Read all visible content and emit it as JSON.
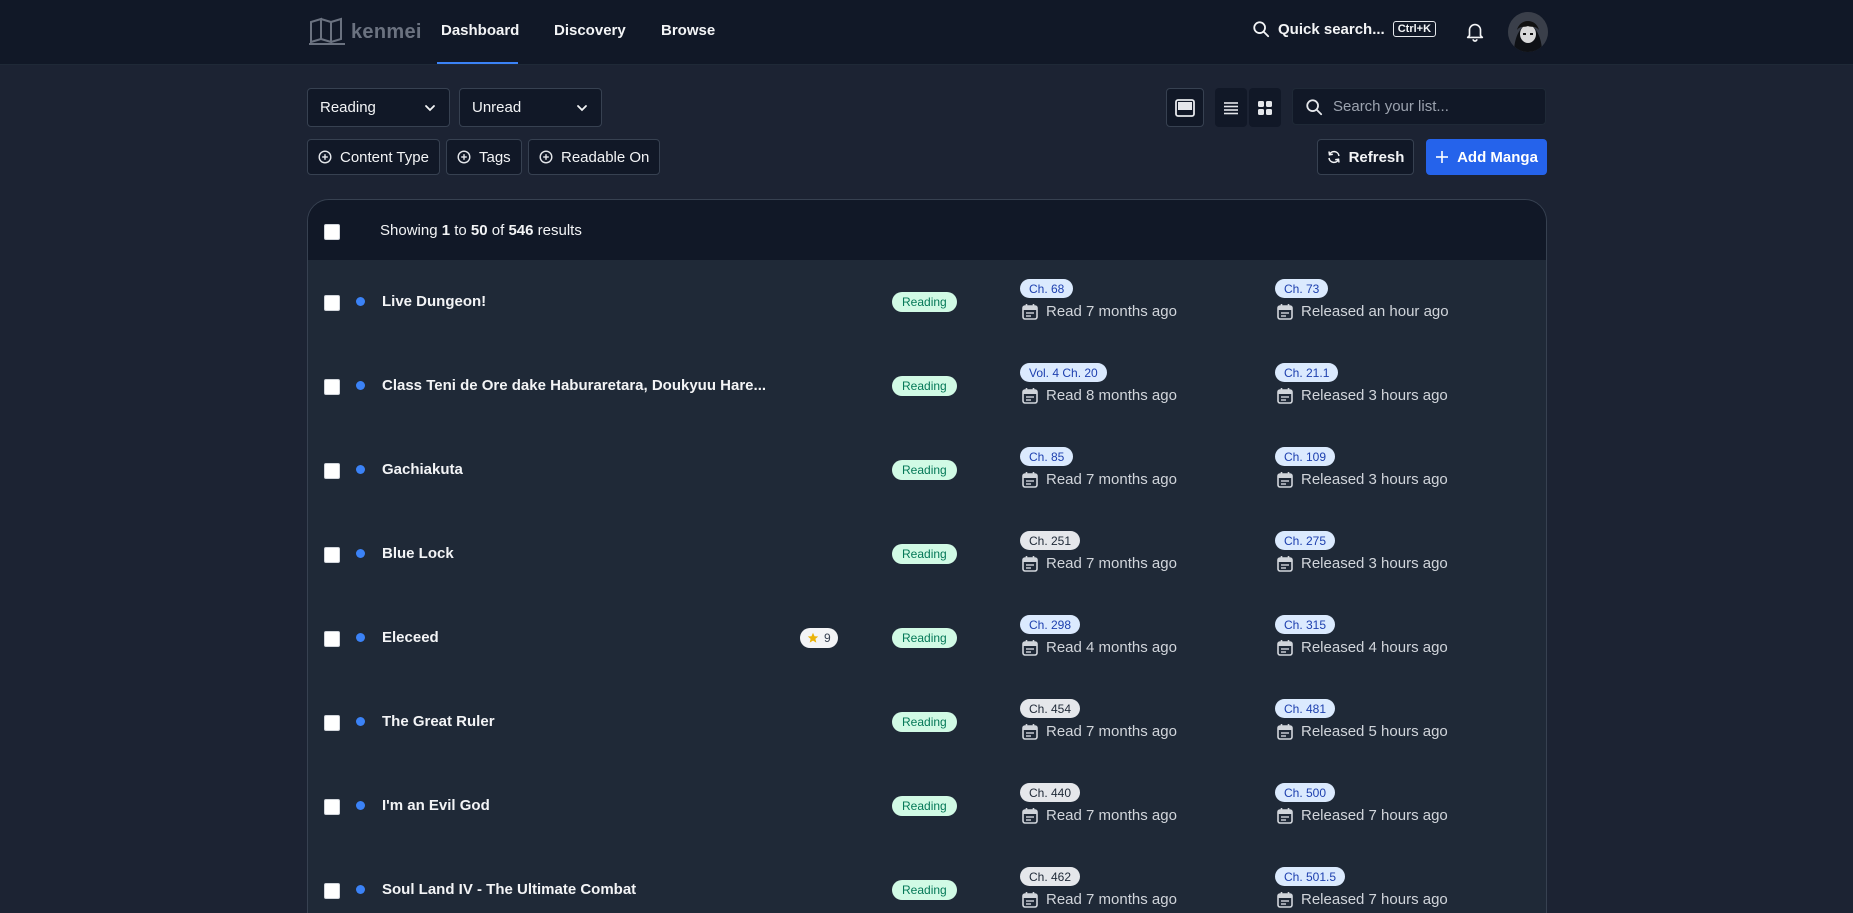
{
  "nav": {
    "logo_text": "kenmei",
    "links": [
      "Dashboard",
      "Discovery",
      "Browse"
    ],
    "quick_search": "Quick search...",
    "shortcut": "Ctrl+K"
  },
  "filters": {
    "status_select": "Reading",
    "read_select": "Unread",
    "search_placeholder": "Search your list...",
    "chips": [
      "Content Type",
      "Tags",
      "Readable On"
    ],
    "refresh_label": "Refresh",
    "add_label": "Add Manga"
  },
  "table": {
    "showing_prefix": "Showing",
    "from": "1",
    "to_word": "to",
    "to": "50",
    "of_word": "of",
    "total": "546",
    "results_word": "results",
    "rows": [
      {
        "title": "Live Dungeon!",
        "rating": "",
        "status": "Reading",
        "read_ch": "Ch. 68",
        "read_ago": "Read 7 months ago",
        "latest_ch": "Ch. 73",
        "released": "Released an hour ago"
      },
      {
        "title": "Class Teni de Ore dake Haburaretara, Doukyuu Hare...",
        "rating": "",
        "status": "Reading",
        "read_ch": "Vol. 4 Ch. 20",
        "read_ago": "Read 8 months ago",
        "latest_ch": "Ch. 21.1",
        "released": "Released 3 hours ago"
      },
      {
        "title": "Gachiakuta",
        "rating": "",
        "status": "Reading",
        "read_ch": "Ch. 85",
        "read_ago": "Read 7 months ago",
        "latest_ch": "Ch. 109",
        "released": "Released 3 hours ago"
      },
      {
        "title": "Blue Lock",
        "rating": "",
        "status": "Reading",
        "read_ch": "Ch. 251",
        "read_ago": "Read 7 months ago",
        "latest_ch": "Ch. 275",
        "released": "Released 3 hours ago"
      },
      {
        "title": "Eleceed",
        "rating": "9",
        "status": "Reading",
        "read_ch": "Ch. 298",
        "read_ago": "Read 4 months ago",
        "latest_ch": "Ch. 315",
        "released": "Released 4 hours ago"
      },
      {
        "title": "The Great Ruler",
        "rating": "",
        "status": "Reading",
        "read_ch": "Ch. 454",
        "read_ago": "Read 7 months ago",
        "latest_ch": "Ch. 481",
        "released": "Released 5 hours ago"
      },
      {
        "title": "I'm an Evil God",
        "rating": "",
        "status": "Reading",
        "read_ch": "Ch. 440",
        "read_ago": "Read 7 months ago",
        "latest_ch": "Ch. 500",
        "released": "Released 7 hours ago"
      },
      {
        "title": "Soul Land IV - The Ultimate Combat",
        "rating": "",
        "status": "Reading",
        "read_ch": "Ch. 462",
        "read_ago": "Read 7 months ago",
        "latest_ch": "Ch. 501.5",
        "released": "Released 7 hours ago"
      }
    ]
  },
  "colors": {
    "background": "#1c2333",
    "topbar": "#111827",
    "accent": "#2563eb",
    "status_badge_bg": "#d1fae5",
    "status_badge_text": "#047857"
  },
  "icons": [
    "logo-icon",
    "search-icon",
    "bell-icon",
    "avatar",
    "chevron-down-icon",
    "inbox-view-icon",
    "list-view-icon",
    "grid-view-icon",
    "plus-circle-icon",
    "refresh-icon",
    "plus-icon",
    "star-icon",
    "calendar-icon"
  ]
}
